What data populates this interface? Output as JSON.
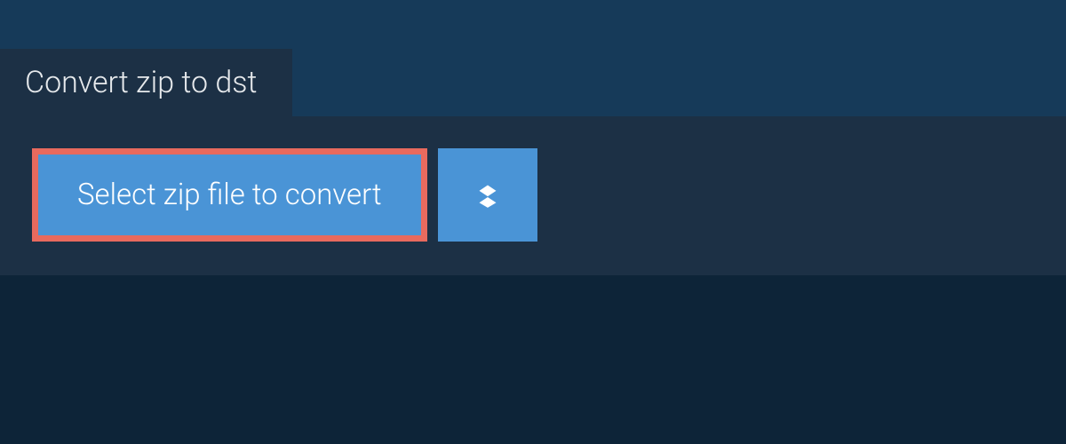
{
  "tab": {
    "title": "Convert zip to dst"
  },
  "actions": {
    "select_label": "Select zip file to convert",
    "dropbox_icon": "dropbox-icon"
  }
}
